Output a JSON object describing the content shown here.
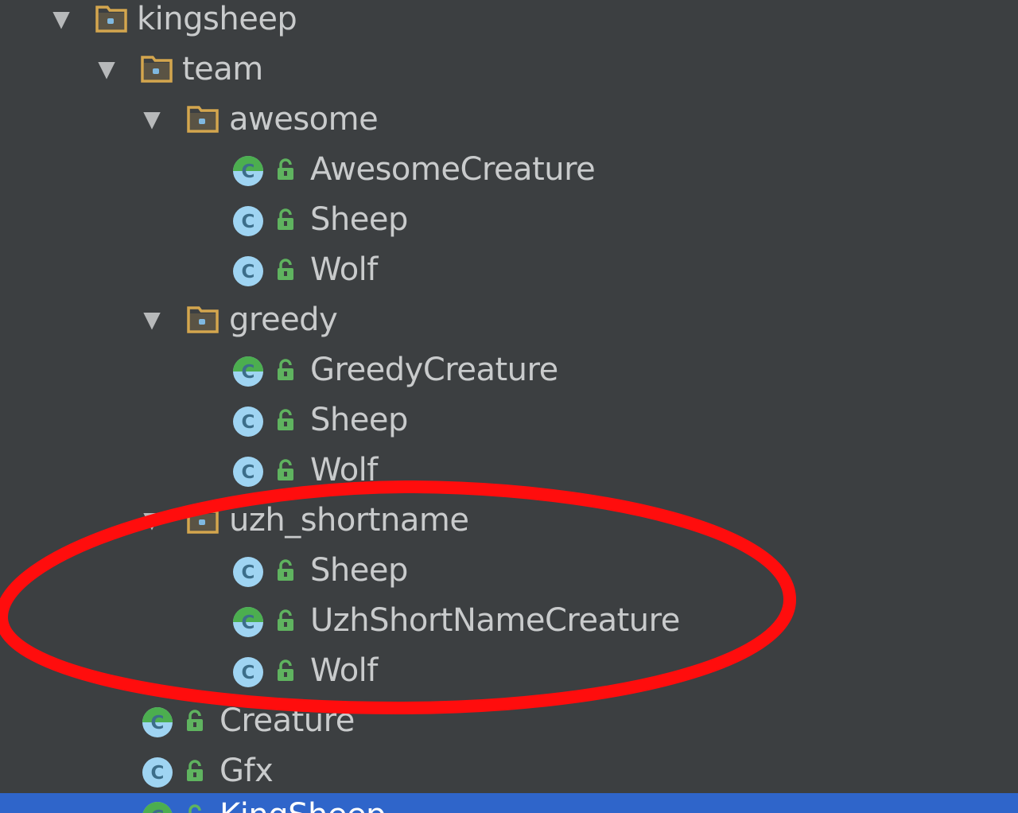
{
  "colors": {
    "background": "#3c3f41",
    "text": "#c9cbcc",
    "folder": "#d4a64e",
    "class_icon": "#9fd4f2",
    "class_letter": "#3c6e8a",
    "abstract_mark": "#4cae4f",
    "lock": "#5fb35f",
    "selection": "#2f65ca",
    "annotation": "#ff0d0d"
  },
  "icons": {
    "expand": "triangle-down-icon",
    "package": "package-folder-icon",
    "class": "class-icon",
    "abstract_class": "abstract-class-icon",
    "visibility": "public-lock-icon"
  },
  "tree": {
    "expand_glyph": "▼",
    "kingsheep": {
      "label": "kingsheep"
    },
    "team": {
      "label": "team"
    },
    "awesome": {
      "label": "awesome",
      "items": [
        "AwesomeCreature",
        "Sheep",
        "Wolf"
      ]
    },
    "greedy": {
      "label": "greedy",
      "items": [
        "GreedyCreature",
        "Sheep",
        "Wolf"
      ]
    },
    "uzh_shortname": {
      "label": "uzh_shortname",
      "items": [
        "Sheep",
        "UzhShortNameCreature",
        "Wolf"
      ]
    },
    "root_items": [
      "Creature",
      "Gfx",
      "KingSheep"
    ]
  }
}
